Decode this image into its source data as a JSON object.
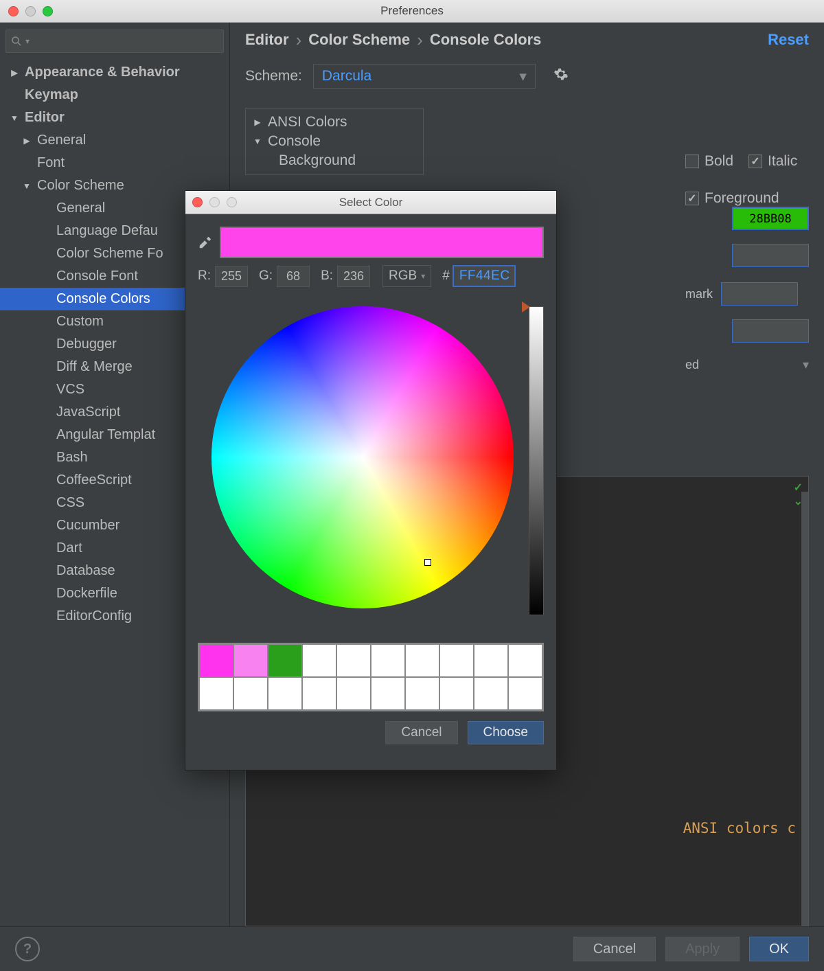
{
  "window": {
    "title": "Preferences",
    "traffic": {
      "close": "#ff5f57",
      "min": "#cfcfcf",
      "max": "#28c840"
    }
  },
  "sidebar": {
    "search_placeholder": "",
    "items": [
      {
        "label": "Appearance & Behavior",
        "depth": 0,
        "bold": true,
        "arrow": "▶"
      },
      {
        "label": "Keymap",
        "depth": 0,
        "bold": true,
        "arrow": ""
      },
      {
        "label": "Editor",
        "depth": 0,
        "bold": true,
        "arrow": "▼"
      },
      {
        "label": "General",
        "depth": 1,
        "bold": false,
        "arrow": "▶"
      },
      {
        "label": "Font",
        "depth": 1,
        "bold": false,
        "arrow": ""
      },
      {
        "label": "Color Scheme",
        "depth": 1,
        "bold": false,
        "arrow": "▼"
      },
      {
        "label": "General",
        "depth": 2,
        "bold": false,
        "arrow": ""
      },
      {
        "label": "Language Defau",
        "depth": 2,
        "bold": false,
        "arrow": ""
      },
      {
        "label": "Color Scheme Fo",
        "depth": 2,
        "bold": false,
        "arrow": ""
      },
      {
        "label": "Console Font",
        "depth": 2,
        "bold": false,
        "arrow": ""
      },
      {
        "label": "Console Colors",
        "depth": 2,
        "bold": false,
        "arrow": "",
        "selected": true
      },
      {
        "label": "Custom",
        "depth": 2,
        "bold": false,
        "arrow": ""
      },
      {
        "label": "Debugger",
        "depth": 2,
        "bold": false,
        "arrow": ""
      },
      {
        "label": "Diff & Merge",
        "depth": 2,
        "bold": false,
        "arrow": ""
      },
      {
        "label": "VCS",
        "depth": 2,
        "bold": false,
        "arrow": ""
      },
      {
        "label": "JavaScript",
        "depth": 2,
        "bold": false,
        "arrow": ""
      },
      {
        "label": "Angular Templat",
        "depth": 2,
        "bold": false,
        "arrow": ""
      },
      {
        "label": "Bash",
        "depth": 2,
        "bold": false,
        "arrow": ""
      },
      {
        "label": "CoffeeScript",
        "depth": 2,
        "bold": false,
        "arrow": ""
      },
      {
        "label": "CSS",
        "depth": 2,
        "bold": false,
        "arrow": ""
      },
      {
        "label": "Cucumber",
        "depth": 2,
        "bold": false,
        "arrow": ""
      },
      {
        "label": "Dart",
        "depth": 2,
        "bold": false,
        "arrow": ""
      },
      {
        "label": "Database",
        "depth": 2,
        "bold": false,
        "arrow": ""
      },
      {
        "label": "Dockerfile",
        "depth": 2,
        "bold": false,
        "arrow": ""
      },
      {
        "label": "EditorConfig",
        "depth": 2,
        "bold": false,
        "arrow": ""
      }
    ]
  },
  "breadcrumbs": [
    "Editor",
    "Color Scheme",
    "Console Colors"
  ],
  "reset_label": "Reset",
  "scheme_label": "Scheme:",
  "scheme_value": "Darcula",
  "opts_tree": {
    "ansi": "ANSI Colors",
    "console": "Console",
    "background": "Background"
  },
  "attrs": {
    "bold": "Bold",
    "italic": "Italic",
    "foreground": "Foreground",
    "mark_fragment": "mark",
    "end_fragment": "ed",
    "color_hex": "28BB08"
  },
  "preview_text": "ANSI colors c",
  "footer": {
    "cancel": "Cancel",
    "apply": "Apply",
    "ok": "OK"
  },
  "color_dialog": {
    "title": "Select Color",
    "preview_color": "#ff44ec",
    "r_label": "R:",
    "g_label": "G:",
    "b_label": "B:",
    "r": "255",
    "g": "68",
    "b": "236",
    "mode": "RGB",
    "hash": "#",
    "hex": "FF44EC",
    "swatches": [
      "#ff33ee",
      "#f882f0",
      "#2a9f1b"
    ],
    "cancel": "Cancel",
    "choose": "Choose"
  }
}
